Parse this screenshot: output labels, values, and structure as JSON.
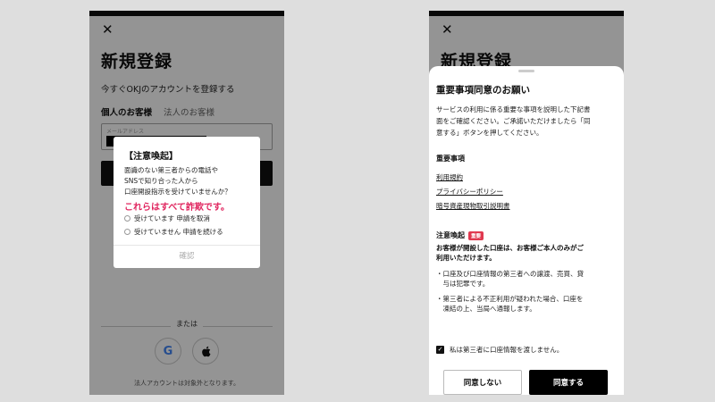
{
  "screen_left": {
    "close_glyph": "✕",
    "title": "新規登録",
    "subtitle": "今すぐOKJのアカウントを登録する",
    "tabs": [
      "個人のお客様",
      "法人のお客様"
    ],
    "email_label": "メールアドレス",
    "or_text": "または",
    "google_glyph": "G",
    "corporate_note": "法人アカウントは対象外となります。",
    "dialog": {
      "title": "【注意喚起】",
      "body_lines": [
        "面識のない第三者からの電話や",
        "SNSで知り合った人から",
        "口座開設指示を受けていませんか？"
      ],
      "warning": "これらはすべて詐欺です。",
      "options": [
        "受けています 申請を取消",
        "受けていません 申請を続ける"
      ],
      "confirm_label": "確認"
    }
  },
  "screen_right": {
    "close_glyph": "✕",
    "title": "新規登録",
    "sheet": {
      "title": "重要事項同意のお願い",
      "description_lines": [
        "サービスの利用に係る重要な事項を説明した下記書",
        "面をご確認ください。ご承諾いただけましたら「同",
        "意する」ボタンを押してください。"
      ],
      "important_heading": "重要事項",
      "links": [
        "利用規約",
        "プライバシーポリシー",
        "暗号資産現物取引説明書"
      ],
      "caution_heading": "注意喚起",
      "caution_badge": "重要",
      "caution_bold_lines": [
        "お客様が開設した口座は、お客様ご本人のみがご",
        "利用いただけます。"
      ],
      "bullets": [
        [
          "・口座及び口座情報の第三者への譲渡、売買、貸",
          "　与は犯罪です。"
        ],
        [
          "・第三者による不正利用が疑われた場合、口座を",
          "　凍結の上、当局へ通報します。"
        ]
      ],
      "checkbox_label": "私は第三者に口座情報を渡しません。",
      "checkbox_checked": true,
      "disagree_label": "同意しない",
      "agree_label": "同意する"
    }
  },
  "colors": {
    "warning_pink": "#e0245e",
    "badge_red": "#e0394f",
    "agree_button": "#000000"
  }
}
